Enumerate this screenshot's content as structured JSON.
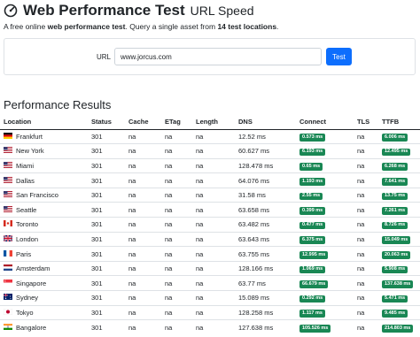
{
  "header": {
    "title": "Web Performance Test",
    "subtitle": "URL Speed"
  },
  "intro": {
    "prefix": "A free online ",
    "bold1": "web performance test",
    "middle": ". Query a single asset from ",
    "bold2": "14 test locations",
    "suffix": "."
  },
  "url_form": {
    "label": "URL",
    "value": "www.jorcus.com",
    "button_label": "Test"
  },
  "results": {
    "title": "Performance Results",
    "columns": [
      "Location",
      "Status",
      "Cache",
      "ETag",
      "Length",
      "DNS",
      "Connect",
      "TLS",
      "TTFB"
    ],
    "rows": [
      {
        "location": "Frankfurt",
        "flag": "de",
        "status": "301",
        "cache": "na",
        "etag": "na",
        "length": "na",
        "dns": "12.52 ms",
        "connect": "0.573 ms",
        "tls": "na",
        "ttfb": "6.006 ms"
      },
      {
        "location": "New York",
        "flag": "us",
        "status": "301",
        "cache": "na",
        "etag": "na",
        "length": "na",
        "dns": "60.627 ms",
        "connect": "6.193 ms",
        "tls": "na",
        "ttfb": "12.495 ms"
      },
      {
        "location": "Miami",
        "flag": "us",
        "status": "301",
        "cache": "na",
        "etag": "na",
        "length": "na",
        "dns": "128.478 ms",
        "connect": "0.65 ms",
        "tls": "na",
        "ttfb": "6.268 ms"
      },
      {
        "location": "Dallas",
        "flag": "us",
        "status": "301",
        "cache": "na",
        "etag": "na",
        "length": "na",
        "dns": "64.076 ms",
        "connect": "1.193 ms",
        "tls": "na",
        "ttfb": "7.641 ms"
      },
      {
        "location": "San Francisco",
        "flag": "us",
        "status": "301",
        "cache": "na",
        "etag": "na",
        "length": "na",
        "dns": "31.58 ms",
        "connect": "2.55 ms",
        "tls": "na",
        "ttfb": "13.75 ms"
      },
      {
        "location": "Seattle",
        "flag": "us",
        "status": "301",
        "cache": "na",
        "etag": "na",
        "length": "na",
        "dns": "63.658 ms",
        "connect": "0.399 ms",
        "tls": "na",
        "ttfb": "7.261 ms"
      },
      {
        "location": "Toronto",
        "flag": "ca",
        "status": "301",
        "cache": "na",
        "etag": "na",
        "length": "na",
        "dns": "63.482 ms",
        "connect": "0.477 ms",
        "tls": "na",
        "ttfb": "8.726 ms"
      },
      {
        "location": "London",
        "flag": "gb",
        "status": "301",
        "cache": "na",
        "etag": "na",
        "length": "na",
        "dns": "63.643 ms",
        "connect": "6.375 ms",
        "tls": "na",
        "ttfb": "15.049 ms"
      },
      {
        "location": "Paris",
        "flag": "fr",
        "status": "301",
        "cache": "na",
        "etag": "na",
        "length": "na",
        "dns": "63.755 ms",
        "connect": "12.995 ms",
        "tls": "na",
        "ttfb": "20.063 ms"
      },
      {
        "location": "Amsterdam",
        "flag": "nl",
        "status": "301",
        "cache": "na",
        "etag": "na",
        "length": "na",
        "dns": "128.166 ms",
        "connect": "1.069 ms",
        "tls": "na",
        "ttfb": "5.908 ms"
      },
      {
        "location": "Singapore",
        "flag": "sg",
        "status": "301",
        "cache": "na",
        "etag": "na",
        "length": "na",
        "dns": "63.77 ms",
        "connect": "66.679 ms",
        "tls": "na",
        "ttfb": "137.638 ms"
      },
      {
        "location": "Sydney",
        "flag": "au",
        "status": "301",
        "cache": "na",
        "etag": "na",
        "length": "na",
        "dns": "15.089 ms",
        "connect": "0.292 ms",
        "tls": "na",
        "ttfb": "5.471 ms"
      },
      {
        "location": "Tokyo",
        "flag": "jp",
        "status": "301",
        "cache": "na",
        "etag": "na",
        "length": "na",
        "dns": "128.258 ms",
        "connect": "1.117 ms",
        "tls": "na",
        "ttfb": "9.485 ms"
      },
      {
        "location": "Bangalore",
        "flag": "in",
        "status": "301",
        "cache": "na",
        "etag": "na",
        "length": "na",
        "dns": "127.638 ms",
        "connect": "105.526 ms",
        "tls": "na",
        "ttfb": "214.803 ms"
      }
    ]
  },
  "colors": {
    "badge": "#198754",
    "button": "#0d6efd",
    "text": "#212529"
  }
}
